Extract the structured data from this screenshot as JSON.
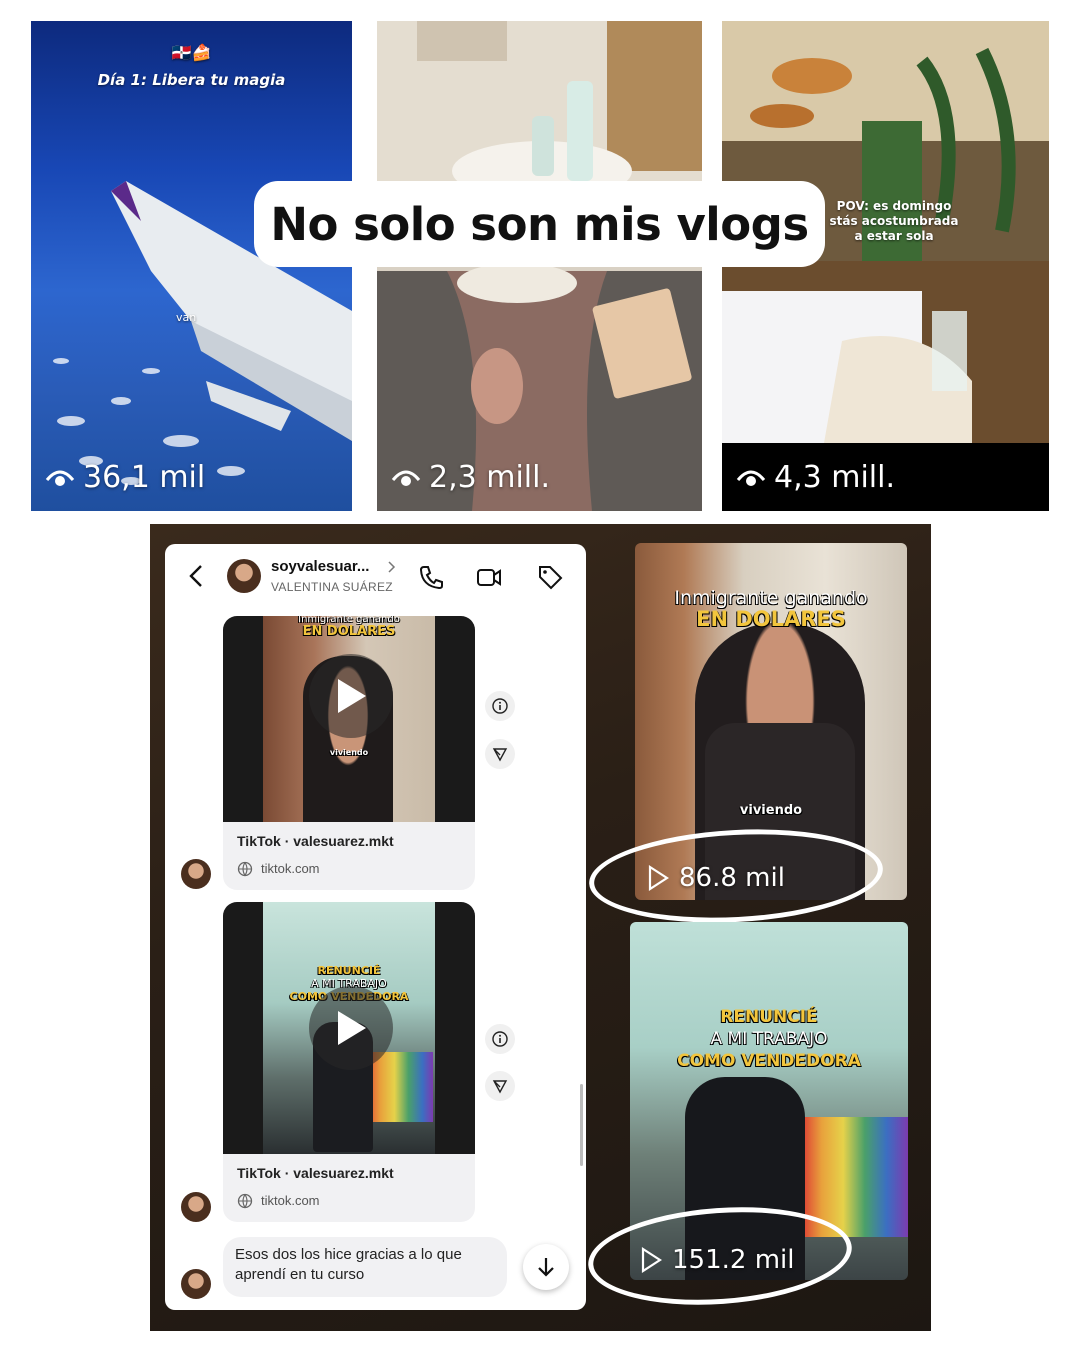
{
  "headline": "No solo son mis vlogs",
  "top_videos": [
    {
      "overlay": "Día 1: Libera tu magia",
      "wing_text": "van",
      "views": "36,1 mil"
    },
    {
      "views": "2,3 mill."
    },
    {
      "overlay_lines": [
        "POV: es domingo",
        "stás acostumbrada",
        "a estar sola"
      ],
      "views": "4,3 mill."
    }
  ],
  "chat": {
    "username": "soyvalesuar...",
    "display_name": "VALENTINA SUÁREZ",
    "messages": [
      {
        "video_caption_top": "Inmigrante ganando",
        "video_caption_main": "EN DOLARES",
        "video_word": "viviendo",
        "title": "TikTok · valesuarez.mkt",
        "domain": "tiktok.com"
      },
      {
        "video_caption_lines": [
          "RENUNCIÉ",
          "A MI TRABAJO",
          "COMO VENDEDORA"
        ],
        "title": "TikTok · valesuarez.mkt",
        "domain": "tiktok.com"
      }
    ],
    "reply_text": "Esos dos los hice gracias a lo que aprendí en tu curso"
  },
  "tiktok_videos": [
    {
      "caption_top": "Inmigrante ganando",
      "caption_main": "EN DOLARES",
      "word": "viviendo",
      "plays": "86.8 mil"
    },
    {
      "caption_lines": [
        "RENUNCIÉ",
        "A MI TRABAJO",
        "COMO VENDEDORA"
      ],
      "plays": "151.2 mil"
    }
  ],
  "icons": [
    "eye-icon",
    "back-chevron-icon",
    "phone-icon",
    "video-call-icon",
    "tag-icon",
    "info-icon",
    "share-icon",
    "globe-icon",
    "play-icon",
    "arrow-down-icon"
  ],
  "colors": {
    "caption_yellow": "#f2c53d",
    "headline_bg": "#ffffff"
  }
}
